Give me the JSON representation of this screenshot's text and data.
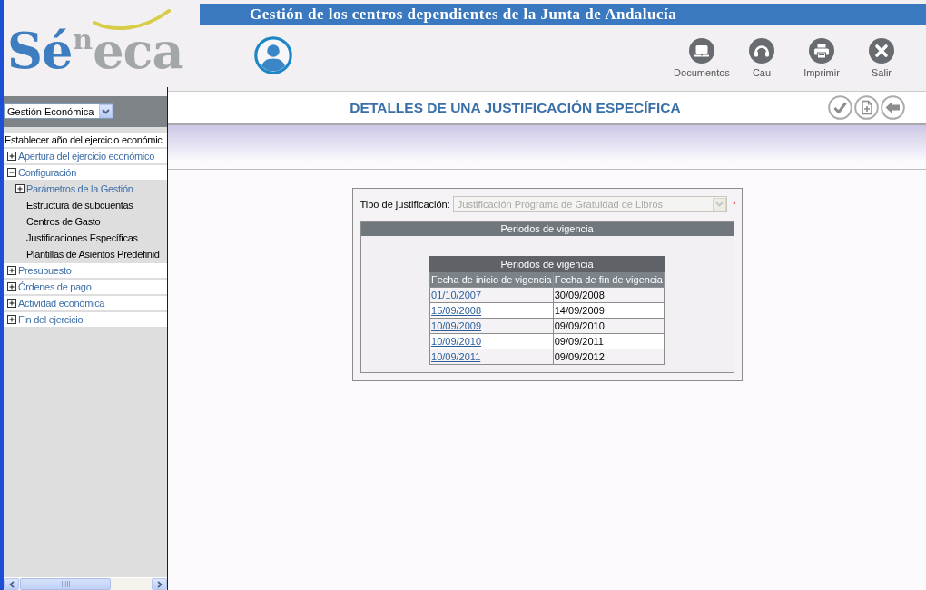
{
  "header": {
    "logo": {
      "lead": "Sé",
      "raised": "n",
      "tail": "eca"
    },
    "banner": "Gestión de los centros dependientes de la Junta de Andalucía",
    "tools": [
      {
        "kind": "laptop",
        "label": "Documentos"
      },
      {
        "kind": "headset",
        "label": "Cau"
      },
      {
        "kind": "printer",
        "label": "Imprimir"
      },
      {
        "kind": "close",
        "label": "Salir"
      }
    ]
  },
  "sidebar": {
    "module_select": {
      "value": "Gestión Económica"
    },
    "menu": [
      {
        "kind": "leaf",
        "label": "Establecer año del ejercicio económic"
      },
      {
        "kind": "folder",
        "label": "Apertura del ejercicio económico",
        "expanded": false
      },
      {
        "kind": "folder",
        "label": "Configuración",
        "expanded": true,
        "children": [
          {
            "kind": "folder",
            "label": "Parámetros de la Gestión",
            "expanded": false
          },
          {
            "kind": "leaf",
            "label": "Estructura de subcuentas"
          },
          {
            "kind": "leaf",
            "label": "Centros de Gasto"
          },
          {
            "kind": "leaf",
            "label": "Justificaciones Específicas"
          },
          {
            "kind": "leaf",
            "label": "Plantillas de Asientos Predefinid"
          }
        ]
      },
      {
        "kind": "folder",
        "label": "Presupuesto",
        "expanded": false
      },
      {
        "kind": "folder",
        "label": "Órdenes de pago",
        "expanded": false
      },
      {
        "kind": "folder",
        "label": "Actividad económica",
        "expanded": false
      },
      {
        "kind": "folder",
        "label": "Fin del ejercicio",
        "expanded": false
      }
    ]
  },
  "page": {
    "title": "DETALLES DE UNA JUSTIFICACIÓN ESPECÍFICA"
  },
  "form": {
    "type_field": {
      "label": "Tipo de justificación:",
      "value": "Justificación Programa de Gratuidad de Libros",
      "disabled": true,
      "required_mark": "*"
    },
    "periods_panel": {
      "title": "Periodos de vigencia",
      "table": {
        "caption": "Periodos de vigencia",
        "columns": [
          "Fecha de inicio de vigencia",
          "Fecha de fin de vigencia"
        ],
        "rows": [
          {
            "start": "01/10/2007",
            "end": "30/09/2008"
          },
          {
            "start": "15/09/2008",
            "end": "14/09/2009"
          },
          {
            "start": "10/09/2009",
            "end": "09/09/2010"
          },
          {
            "start": "10/09/2010",
            "end": "09/09/2011"
          },
          {
            "start": "10/09/2011",
            "end": "09/09/2012"
          }
        ]
      }
    }
  }
}
